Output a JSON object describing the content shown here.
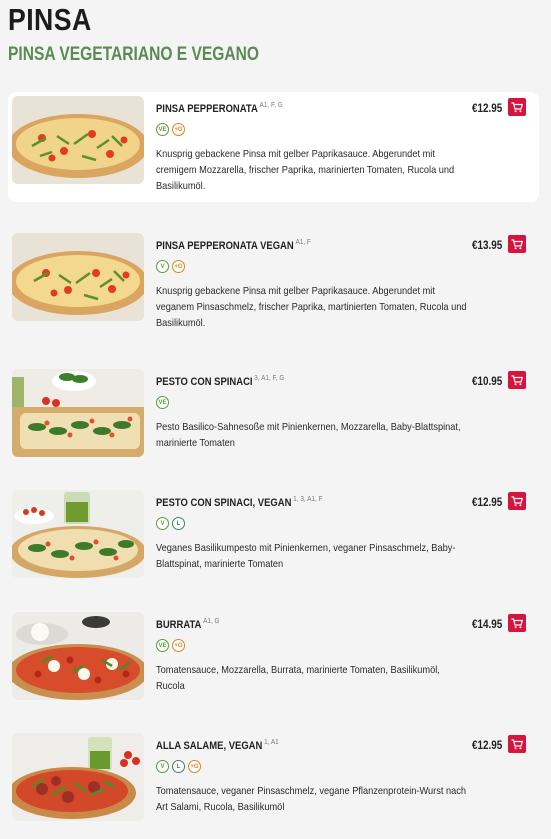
{
  "heading": "PINSA",
  "section_title": "PINSA VEGETARIANO E VEGANO",
  "colors": {
    "accent": "#5c8a55",
    "cart": "#d6143e",
    "veg_badge": "#5a9a3c",
    "plus_badge": "#d4871f"
  },
  "items": [
    {
      "name": "PINSA PEPPERONATA",
      "allergens": "A1, F, G",
      "badges": [
        "VE",
        "+G"
      ],
      "description": "Knusprig gebackene Pinsa mit gelber Paprikasauce. Abgerundet mit cremigem Mozzarella, frischer Paprika, marinierten Tomaten, Rucola und Basilikumöl.",
      "price": "€12.95",
      "cart_icon": "shopping-cart-icon",
      "image": "pinsa-pepperonata-photo"
    },
    {
      "name": "PINSA PEPPERONATA VEGAN",
      "allergens": "A1, F",
      "badges": [
        "V",
        "+G"
      ],
      "description": "Knusprig gebackene Pinsa mit gelber Paprikasauce. Abgerundet mit veganem Pinsaschmelz, frischer Paprika, martinierten Tomaten, Rucola und Basilikumöl.",
      "price": "€13.95",
      "cart_icon": "shopping-cart-icon",
      "image": "pinsa-pepperonata-vegan-photo"
    },
    {
      "name": "PESTO CON SPINACI",
      "allergens": "3, A1, F, G",
      "badges": [
        "VE"
      ],
      "description": "Pesto Basilico-Sahnesoße mit Pinienkernen, Mozzarella, Baby-Blattspinat, marinierte Tomaten",
      "price": "€10.95",
      "cart_icon": "shopping-cart-icon",
      "image": "pesto-con-spinaci-photo"
    },
    {
      "name": "PESTO CON SPINACI, VEGAN",
      "allergens": "1, 3, A1, F",
      "badges": [
        "V",
        "L"
      ],
      "description": "Veganes Basilikumpesto mit Pinienkernen, veganer Pinsaschmelz, Baby-Blattspinat, marinierte Tomaten",
      "price": "€12.95",
      "cart_icon": "shopping-cart-icon",
      "image": "pesto-con-spinaci-vegan-photo"
    },
    {
      "name": "BURRATA",
      "allergens": "A1, G",
      "badges": [
        "VE",
        "+G"
      ],
      "description": "Tomatensauce, Mozzarella, Burrata, marinierte Tomaten, Basilikumöl, Rucola",
      "price": "€14.95",
      "cart_icon": "shopping-cart-icon",
      "image": "burrata-photo"
    },
    {
      "name": "ALLA SALAME, VEGAN",
      "allergens": "1, A1",
      "badges": [
        "V",
        "L",
        "+G"
      ],
      "description": "Tomatensauce, veganer Pinsaschmelz, vegane Pflanzenprotein-Wurst nach Art Salami, Rucola, Basilikumöl",
      "price": "€12.95",
      "cart_icon": "shopping-cart-icon",
      "image": "alla-salame-vegan-photo"
    }
  ]
}
